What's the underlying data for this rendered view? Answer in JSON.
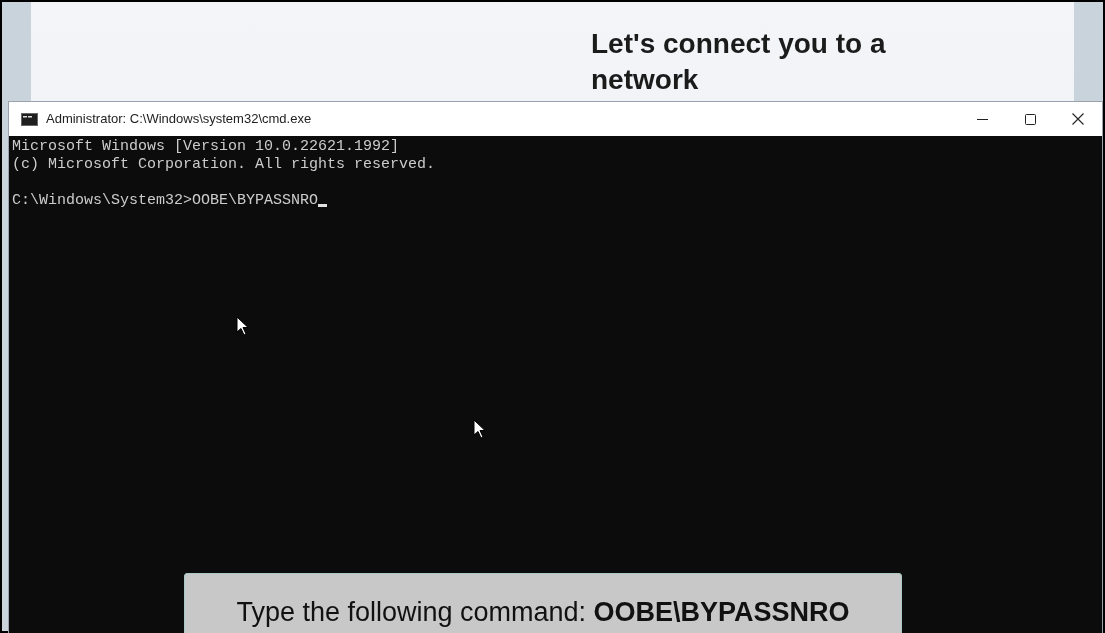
{
  "setup_screen": {
    "heading": "Let's connect you to a network"
  },
  "console_window": {
    "title": "Administrator: C:\\Windows\\system32\\cmd.exe",
    "header_lines": [
      "Microsoft Windows [Version 10.0.22621.1992]",
      "(c) Microsoft Corporation. All rights reserved."
    ],
    "command_line": "C:\\Windows\\System32>OOBE\\BYPASSNRO"
  },
  "caption": "Type the following command: **OOBE\\BYPASSNRO**"
}
